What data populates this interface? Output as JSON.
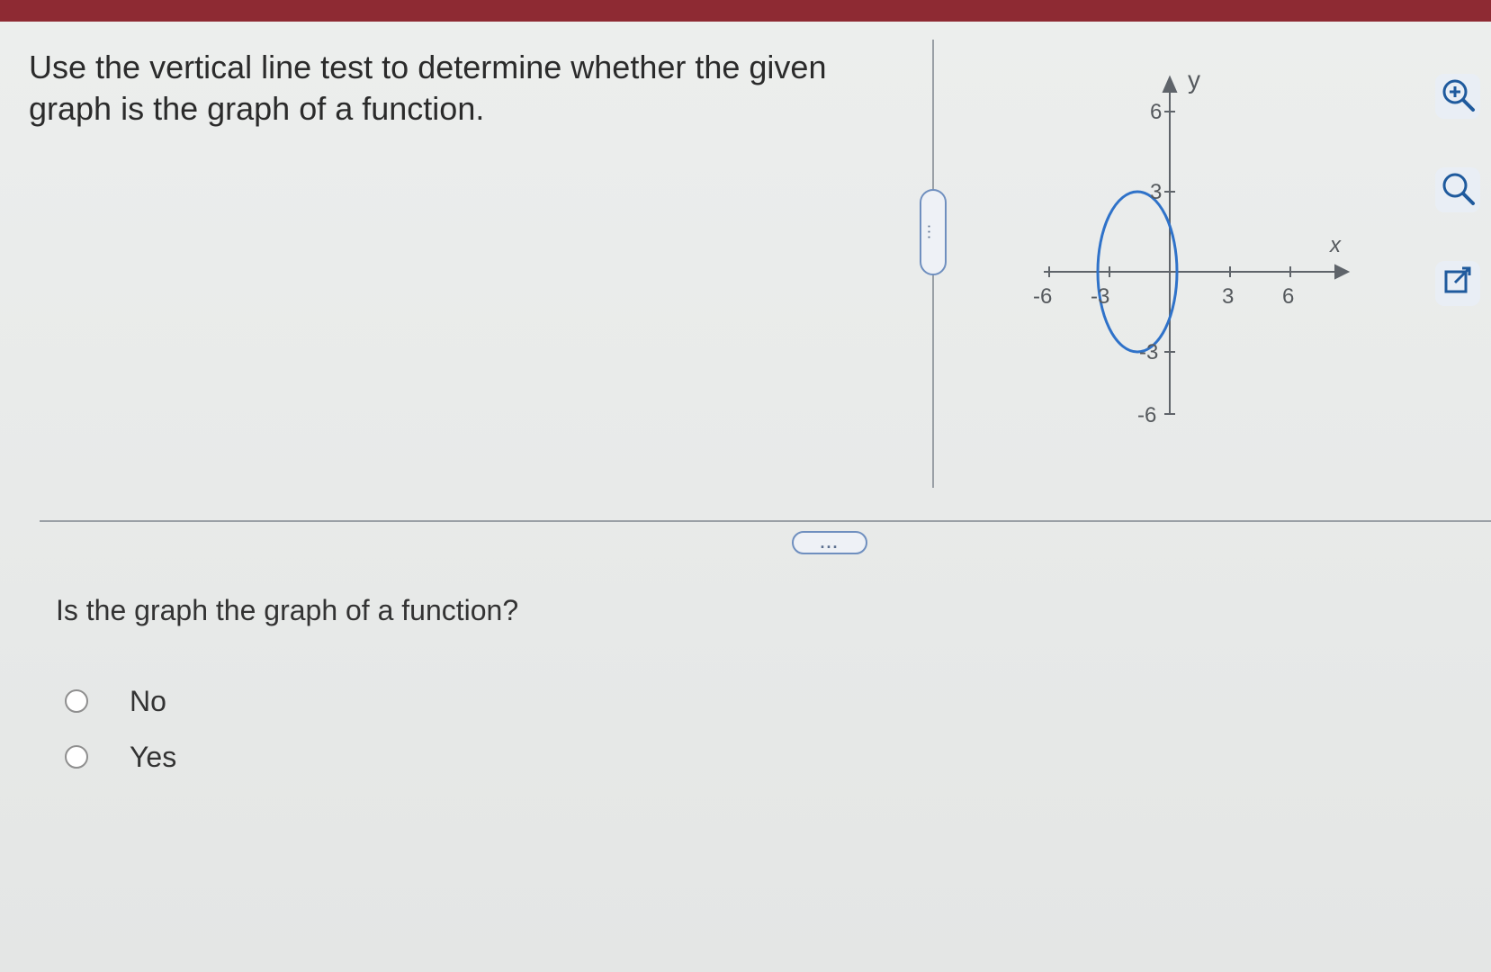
{
  "question": {
    "text": "Use the vertical line test to determine whether the given graph is the graph of a function."
  },
  "graph": {
    "axis_x_label": "x",
    "axis_y_label": "y",
    "x_tick_labels": [
      "-6",
      "-3",
      "3",
      "6"
    ],
    "y_tick_labels": [
      "6",
      "3",
      "-3",
      "-6"
    ],
    "curve_color": "#2f72c9"
  },
  "toolbar": {
    "zoom_in_icon": "zoom-in-icon",
    "zoom_out_icon": "zoom-out-icon",
    "popout_icon": "popout-icon"
  },
  "dividers": {
    "handle_label": "..."
  },
  "answer_section": {
    "prompt": "Is the graph the graph of a function?",
    "options": [
      {
        "label": "No"
      },
      {
        "label": "Yes"
      }
    ]
  }
}
